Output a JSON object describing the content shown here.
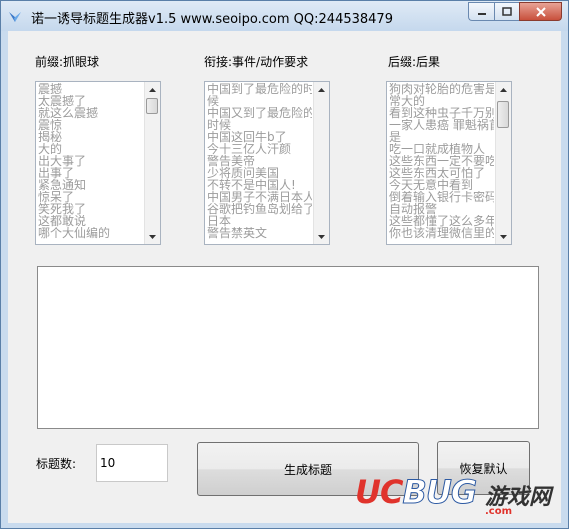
{
  "window": {
    "title": "诺一诱导标题生成器v1.5 www.seoipo.com QQ:244538479"
  },
  "columns": [
    {
      "label": "前缀:抓眼球",
      "items": [
        "震撼",
        "太震撼了",
        "就这么震撼",
        "震惊",
        "揭秘",
        "大的",
        "出大事了",
        "出事了",
        "紧急通知",
        "惊呆了",
        "笑死我了",
        "这都敢说",
        "哪个大仙编的"
      ]
    },
    {
      "label": "衔接:事件/动作要求",
      "items": [
        "中国到了最危险的时",
        "候",
        "中国又到了最危险的",
        "时候",
        "中国这回牛b了",
        "今十三亿人汗颜",
        "警告美帝",
        "少将质问美国",
        "不转不是中国人!",
        "中国男子不满日本人",
        "谷歌把钓鱼岛划给了",
        "日本",
        "警告禁英文"
      ]
    },
    {
      "label": "后缀:后果",
      "items": [
        "狗肉对轮胎的危害是非",
        "常大的",
        "看到这种虫子千万别打",
        "一家人患癌 罪魁祸首竟",
        "是",
        "吃一口就成植物人",
        "这些东西一定不要吃",
        "这些东西太可怕了",
        "今天无意中看到",
        "倒着输入银行卡密码能",
        "自动报警",
        "这些都懂了这么多年",
        "你也该清理微信里的死"
      ]
    }
  ],
  "output": {
    "value": ""
  },
  "count": {
    "label": "标题数:",
    "value": "10"
  },
  "buttons": {
    "generate": "生成标题",
    "reset": "恢复默认"
  },
  "watermark": {
    "uc": "UC",
    "bug": "BUG",
    "cn": "游戏网",
    "url": ".com"
  }
}
